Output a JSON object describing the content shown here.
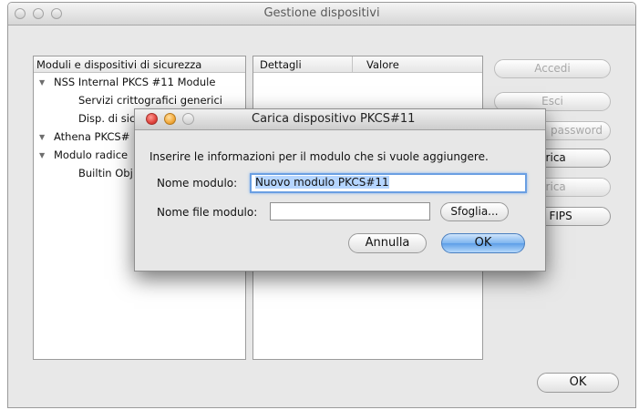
{
  "window": {
    "title": "Gestione dispositivi"
  },
  "left_panel": {
    "header": "Moduli e dispositivi di sicurezza",
    "items": [
      {
        "label": "NSS Internal PKCS #11 Module",
        "expanded": true
      },
      {
        "label": "Servizi crittografici generici"
      },
      {
        "label": "Disp. di sic"
      },
      {
        "label": "Athena PKCS#",
        "expanded": true
      },
      {
        "label": "Modulo radice",
        "expanded": true
      },
      {
        "label": "Builtin Obj"
      }
    ]
  },
  "details_panel": {
    "col_details": "Dettagli",
    "col_value": "Valore"
  },
  "side_buttons": {
    "accedi": "Accedi",
    "esci": "Esci",
    "password": "password",
    "carica": "arica",
    "scarica": "arica",
    "fips": "va FIPS"
  },
  "ok_button": "OK",
  "dialog": {
    "title": "Carica dispositivo PKCS#11",
    "instruction": "Inserire le informazioni per il modulo che si vuole aggiungere.",
    "module_name_label": "Nome modulo:",
    "module_name_value": "Nuovo modulo PKCS#11",
    "module_file_label": "Nome file modulo:",
    "module_file_value": "",
    "browse_button": "Sfoglia...",
    "cancel_button": "Annulla",
    "ok_button": "OK"
  },
  "colors": {
    "close": "#e0443e",
    "minimize": "#f2a93b",
    "focus_ring": "#6a9fe2",
    "selection": "#b5d5ff"
  }
}
